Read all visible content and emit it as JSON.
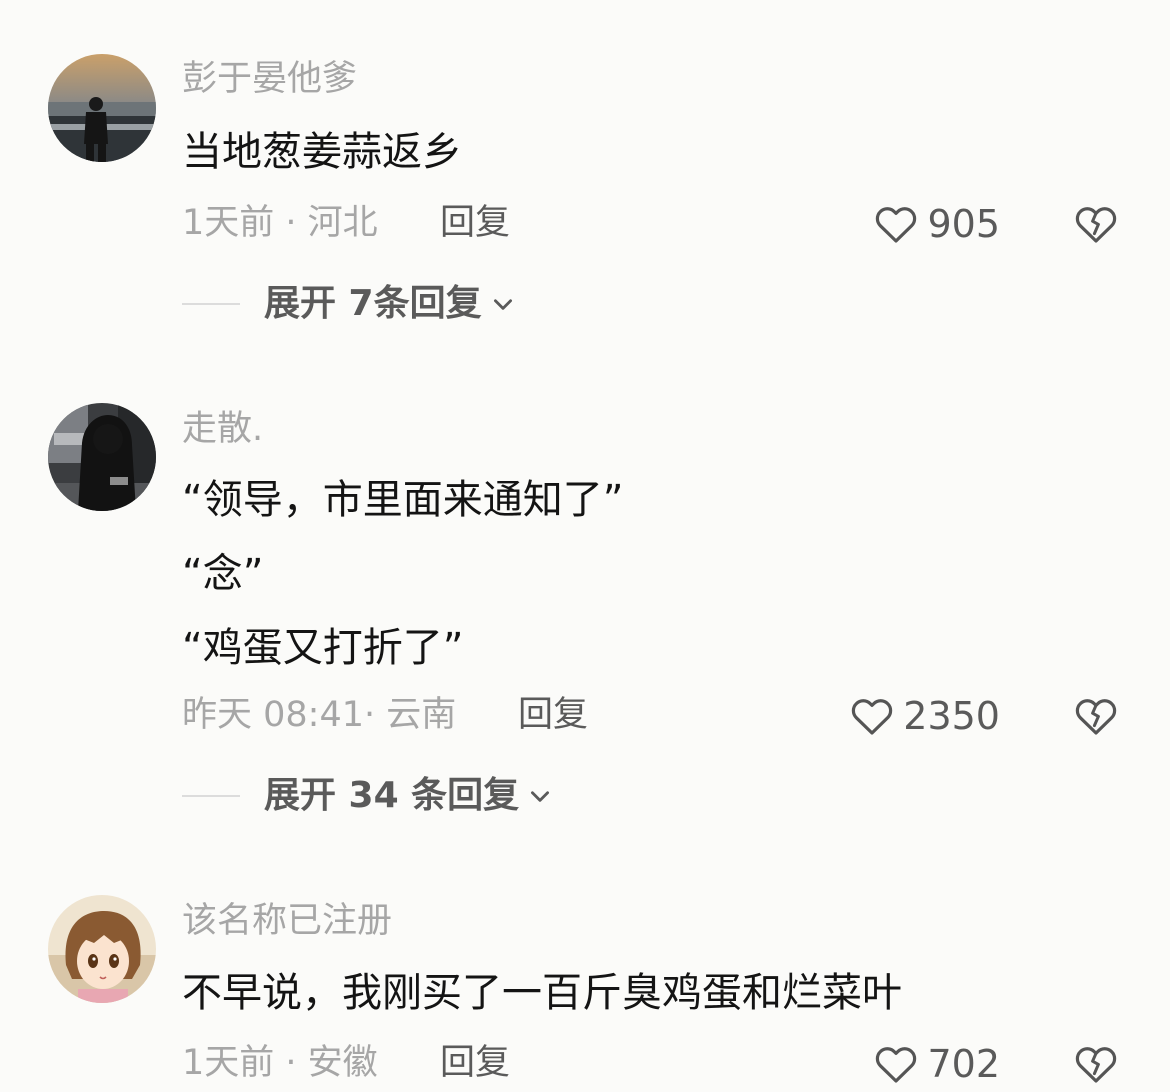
{
  "comments": [
    {
      "username": "彭于晏他爹",
      "content": [
        "当地葱姜蒜返乡"
      ],
      "meta": "1天前 · 河北",
      "reply_label": "回复",
      "likes": "905",
      "expand_label": "展开 7条回复",
      "avatar_icon": "avatar-photo-sunset-sea"
    },
    {
      "username": "走散.",
      "content": [
        "“领导，市里面来通知了”",
        "“念”",
        "“鸡蛋又打折了”"
      ],
      "meta": "昨天 08:41· 云南",
      "reply_label": "回复",
      "likes": "2350",
      "expand_label": "展开 34 条回复",
      "avatar_icon": "avatar-photo-dark-figure"
    },
    {
      "username": "该名称已注册",
      "content": [
        "不早说，我刚买了一百斤臭鸡蛋和烂菜叶"
      ],
      "meta": "1天前 · 安徽",
      "reply_label": "回复",
      "likes": "702",
      "avatar_icon": "avatar-anime-girl"
    }
  ],
  "icons": {
    "like": "heart-outline-icon",
    "dislike": "broken-heart-icon",
    "expand": "chevron-down-icon"
  },
  "colors": {
    "background": "#fbfbf9",
    "text_primary": "#141414",
    "text_secondary": "#a6a6a6",
    "text_action": "#5a5a5a"
  }
}
